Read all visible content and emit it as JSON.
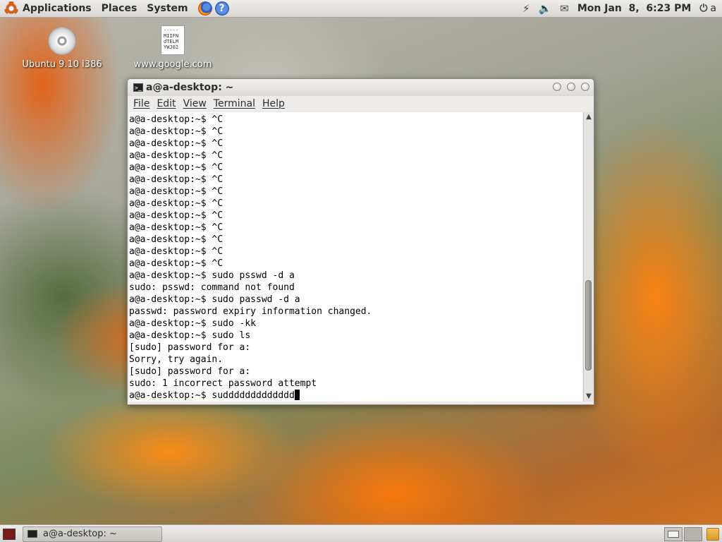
{
  "top_panel": {
    "menus": [
      "Applications",
      "Places",
      "System"
    ],
    "clock": "Mon Jan  8,  6:23 PM",
    "user": "a"
  },
  "desktop_icons": [
    {
      "label": "Ubuntu 9.10 i386",
      "icon": "cd-icon"
    },
    {
      "label": "www.google.com",
      "icon": "text-file-icon",
      "preview": "-----\nMIIFN\ndTELM\nYWJ02"
    }
  ],
  "terminal": {
    "title": "a@a-desktop: ~",
    "menu": [
      "File",
      "Edit",
      "View",
      "Terminal",
      "Help"
    ],
    "lines": [
      "a@a-desktop:~$ ^C",
      "a@a-desktop:~$ ^C",
      "a@a-desktop:~$ ^C",
      "a@a-desktop:~$ ^C",
      "a@a-desktop:~$ ^C",
      "a@a-desktop:~$ ^C",
      "a@a-desktop:~$ ^C",
      "a@a-desktop:~$ ^C",
      "a@a-desktop:~$ ^C",
      "a@a-desktop:~$ ^C",
      "a@a-desktop:~$ ^C",
      "a@a-desktop:~$ ^C",
      "a@a-desktop:~$ ^C",
      "a@a-desktop:~$ sudo psswd -d a",
      "sudo: psswd: command not found",
      "a@a-desktop:~$ sudo passwd -d a",
      "passwd: password expiry information changed.",
      "a@a-desktop:~$ sudo -kk",
      "a@a-desktop:~$ sudo ls",
      "[sudo] password for a:",
      "Sorry, try again.",
      "[sudo] password for a:",
      "sudo: 1 incorrect password attempt"
    ],
    "current_line": "a@a-desktop:~$ suddddddddddddd",
    "scroll_position": 0.88
  },
  "bottom_panel": {
    "task_label": "a@a-desktop: ~"
  }
}
